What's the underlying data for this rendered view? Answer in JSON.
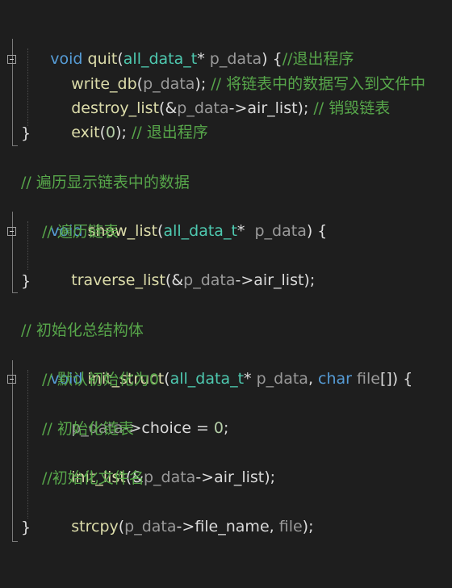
{
  "lines": {
    "l1": {
      "kw": "void",
      "fn": "quit",
      "p1": "(",
      "ty": "all_data_t",
      "p2": "* ",
      "pa": "p_data",
      "p3": ") {",
      "cm": "//退出程序"
    },
    "l2": {
      "fn": "write_db",
      "p1": "(",
      "pa": "p_data",
      "p2": "); ",
      "cm": "// 将链表中的数据写入到文件中"
    },
    "l3": {
      "fn": "destroy_list",
      "p1": "(&",
      "pa": "p_data",
      "p2": "->",
      "mb": "air_list",
      "p3": "); ",
      "cm": "// 销毁链表"
    },
    "l4": {
      "fn": "exit",
      "p1": "(",
      "nm": "0",
      "p2": "); ",
      "cm": "// 退出程序"
    },
    "l5": {
      "p1": "}"
    },
    "l7": {
      "cm": "// 遍历显示链表中的数据"
    },
    "l8": {
      "kw": "void",
      "fn": "show_list",
      "p1": "(",
      "ty": "all_data_t",
      "p2": "*  ",
      "pa": "p_data",
      "p3": ") {"
    },
    "l9": {
      "cm": "// 遍历链表"
    },
    "l10": {
      "fn": "traverse_list",
      "p1": "(&",
      "pa": "p_data",
      "p2": "->",
      "mb": "air_list",
      "p3": ");"
    },
    "l11": {
      "p1": "}"
    },
    "l13": {
      "cm": "// 初始化总结构体"
    },
    "l14": {
      "kw": "void",
      "fn": "init_struct",
      "p1": "(",
      "ty": "all_data_t",
      "p2": "* ",
      "pa": "p_data",
      "p3": ", ",
      "kw2": "char",
      "p4": " ",
      "pa2": "file",
      "p5": "[]) {"
    },
    "l15": {
      "cm": "// 默认初始化为0"
    },
    "l16": {
      "pa": "p_data",
      "p1": "->",
      "mb": "choice",
      "p2": " = ",
      "nm": "0",
      "p3": ";"
    },
    "l17": {
      "cm": "// 初始化链表"
    },
    "l18": {
      "fn": "init_list",
      "p1": "(&",
      "pa": "p_data",
      "p2": "->",
      "mb": "air_list",
      "p3": ");"
    },
    "l19": {
      "cm": "//初始化文件名"
    },
    "l20": {
      "fn": "strcpy",
      "p1": "(",
      "pa": "p_data",
      "p2": "->",
      "mb": "file_name",
      "p3": ", ",
      "pa2": "file",
      "p4": ");"
    },
    "l21": {
      "p1": "}"
    }
  }
}
